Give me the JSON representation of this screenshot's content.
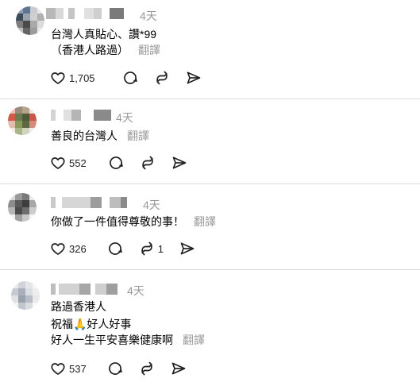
{
  "comments": [
    {
      "time": "4天",
      "lines": [
        "台灣人真貼心、讚*99",
        "（香港人路過）"
      ],
      "translate": "翻譯",
      "likes": "1,705",
      "reposts": ""
    },
    {
      "time": "4天",
      "lines": [
        "善良的台灣人"
      ],
      "translate": "翻譯",
      "likes": "552",
      "reposts": ""
    },
    {
      "time": "4天",
      "lines": [
        "你做了一件值得尊敬的事！"
      ],
      "translate": "翻譯",
      "likes": "326",
      "reposts": "1"
    },
    {
      "time": "4天",
      "lines": [
        "路過香港人",
        "祝福🙏好人好事",
        "好人一生平安喜樂健康啊"
      ],
      "translate": "翻譯",
      "likes": "537",
      "reposts": ""
    }
  ],
  "icons": {
    "like": "heart-icon",
    "reply": "comment-icon",
    "repost": "repost-icon",
    "share": "send-icon"
  },
  "colors": {
    "muted": "#999999",
    "divider": "#dbdbdb"
  }
}
